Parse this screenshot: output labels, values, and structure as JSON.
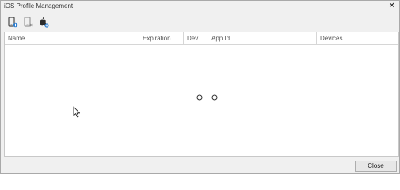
{
  "window": {
    "title": "iOS Profile Management",
    "close_glyph": "✕"
  },
  "toolbar": {
    "buttons": [
      {
        "icon": "add-device-icon"
      },
      {
        "icon": "remove-device-icon"
      },
      {
        "icon": "apple-add-icon"
      }
    ]
  },
  "table": {
    "columns": [
      "Name",
      "Expiration",
      "Dev",
      "App Id",
      "Devices"
    ],
    "rows": [],
    "loading": true
  },
  "footer": {
    "close_label": "Close"
  }
}
